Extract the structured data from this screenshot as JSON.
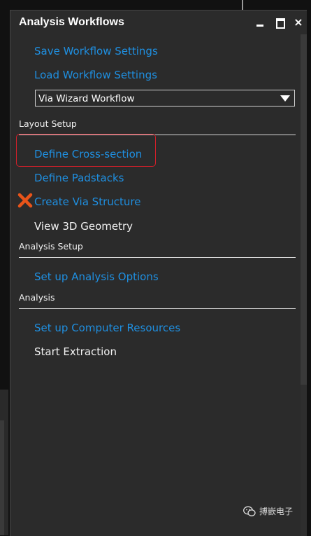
{
  "window": {
    "title": "Analysis Workflows",
    "minimize_label": "minimize",
    "maximize_label": "maximize",
    "close_label": "×"
  },
  "links": {
    "save_workflow": "Save Workflow Settings",
    "load_workflow": "Load Workflow Settings"
  },
  "workflow_select": {
    "value": "Via Wizard Workflow"
  },
  "layout_setup": {
    "heading": "Layout Setup",
    "items": {
      "define_cross_section": "Define Cross-section",
      "define_padstacks": "Define Padstacks",
      "create_via_structure": "Create Via Structure",
      "view_3d_geometry": "View 3D Geometry"
    }
  },
  "analysis_setup": {
    "heading": "Analysis Setup",
    "items": {
      "set_up_analysis_options": "Set up Analysis Options"
    }
  },
  "analysis": {
    "heading": "Analysis",
    "items": {
      "set_up_computer_resources": "Set up Computer Resources",
      "start_extraction": "Start Extraction"
    }
  },
  "watermark": {
    "text": "搏嵌电子",
    "icon": "wechat-icon"
  },
  "colors": {
    "link_blue": "#1f8fe0",
    "panel_bg": "#2b2b2b",
    "highlight_red": "#d0202a",
    "error_x_orange": "#e8541a"
  }
}
